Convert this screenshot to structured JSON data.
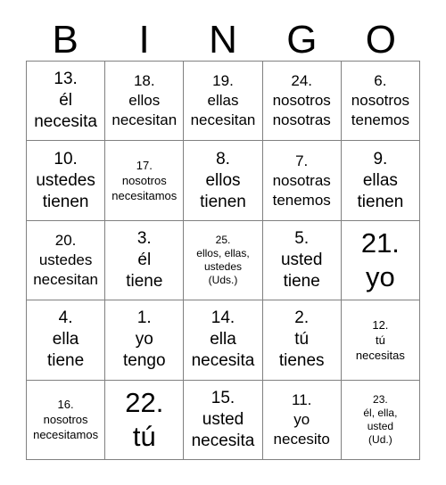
{
  "card": {
    "title": "BINGO",
    "headers": [
      "B",
      "I",
      "N",
      "G",
      "O"
    ],
    "grid_size": "5x5",
    "border_color": "#808080",
    "text_color": "#000000",
    "background_color": "#ffffff",
    "cells": [
      [
        {
          "number": "13.",
          "lines": [
            "13.",
            "él",
            "necesita"
          ],
          "size": "lg"
        },
        {
          "number": "18.",
          "lines": [
            "18.",
            "ellos",
            "necesitan"
          ],
          "size": "md"
        },
        {
          "number": "19.",
          "lines": [
            "19.",
            "ellas",
            "necesitan"
          ],
          "size": "md"
        },
        {
          "number": "24.",
          "lines": [
            "24.",
            "nosotros",
            "nosotras"
          ],
          "size": "md"
        },
        {
          "number": "6.",
          "lines": [
            "6.",
            "nosotros",
            "tenemos"
          ],
          "size": "md"
        }
      ],
      [
        {
          "number": "10.",
          "lines": [
            "10.",
            "ustedes",
            "tienen"
          ],
          "size": "lg"
        },
        {
          "number": "17.",
          "lines": [
            "17.",
            "nosotros",
            "necesitamos"
          ],
          "size": "sm"
        },
        {
          "number": "8.",
          "lines": [
            "8.",
            "ellos",
            "tienen"
          ],
          "size": "lg"
        },
        {
          "number": "7.",
          "lines": [
            "7.",
            "nosotras",
            "tenemos"
          ],
          "size": "md"
        },
        {
          "number": "9.",
          "lines": [
            "9.",
            "ellas",
            "tienen"
          ],
          "size": "lg"
        }
      ],
      [
        {
          "number": "20.",
          "lines": [
            "20.",
            "ustedes",
            "necesitan"
          ],
          "size": "md"
        },
        {
          "number": "3.",
          "lines": [
            "3.",
            "él",
            "tiene"
          ],
          "size": "lg"
        },
        {
          "number": "25.",
          "lines": [
            "25.",
            "ellos, ellas,",
            "ustedes",
            "(Uds.)"
          ],
          "size": "xs"
        },
        {
          "number": "5.",
          "lines": [
            "5.",
            "usted",
            "tiene"
          ],
          "size": "lg"
        },
        {
          "number": "21.",
          "lines": [
            "21.",
            "yo"
          ],
          "size": "xl"
        }
      ],
      [
        {
          "number": "4.",
          "lines": [
            "4.",
            "ella",
            "tiene"
          ],
          "size": "lg"
        },
        {
          "number": "1.",
          "lines": [
            "1.",
            "yo",
            "tengo"
          ],
          "size": "lg"
        },
        {
          "number": "14.",
          "lines": [
            "14.",
            "ella",
            "necesita"
          ],
          "size": "lg"
        },
        {
          "number": "2.",
          "lines": [
            "2.",
            "tú",
            "tienes"
          ],
          "size": "lg"
        },
        {
          "number": "12.",
          "lines": [
            "12.",
            "tú",
            "necesitas"
          ],
          "size": "sm"
        }
      ],
      [
        {
          "number": "16.",
          "lines": [
            "16.",
            "nosotros",
            "necesitamos"
          ],
          "size": "sm"
        },
        {
          "number": "22.",
          "lines": [
            "22.",
            "tú"
          ],
          "size": "xl"
        },
        {
          "number": "15.",
          "lines": [
            "15.",
            "usted",
            "necesita"
          ],
          "size": "lg"
        },
        {
          "number": "11.",
          "lines": [
            "11.",
            "yo",
            "necesito"
          ],
          "size": "md"
        },
        {
          "number": "23.",
          "lines": [
            "23.",
            "él, ella,",
            "usted",
            "(Ud.)"
          ],
          "size": "xs"
        }
      ]
    ]
  }
}
